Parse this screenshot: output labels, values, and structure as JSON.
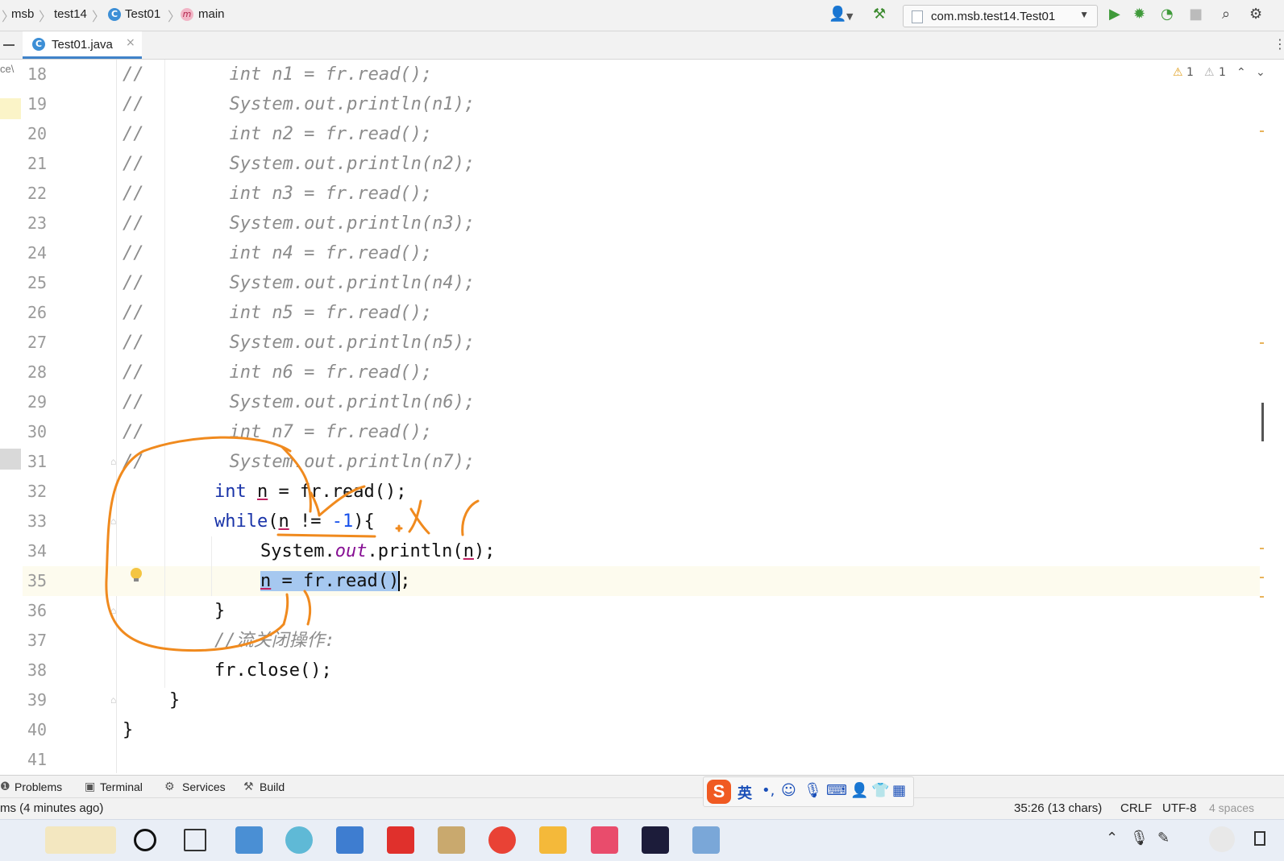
{
  "breadcrumb": {
    "project": "msb",
    "module": "test14",
    "class": "Test01",
    "method": "main"
  },
  "run_config": {
    "label": "com.msb.test14.Test01"
  },
  "tab": {
    "label": "Test01.java"
  },
  "left_cutoff": "ce\\",
  "inspections": {
    "warnings": "1",
    "weak_warnings": "1"
  },
  "code_lines": [
    {
      "n": "18"
    },
    {
      "n": "19"
    },
    {
      "n": "20"
    },
    {
      "n": "21"
    },
    {
      "n": "22"
    },
    {
      "n": "23"
    },
    {
      "n": "24"
    },
    {
      "n": "25"
    },
    {
      "n": "26"
    },
    {
      "n": "27"
    },
    {
      "n": "28"
    },
    {
      "n": "29"
    },
    {
      "n": "30"
    },
    {
      "n": "31"
    },
    {
      "n": "32"
    },
    {
      "n": "33"
    },
    {
      "n": "34"
    },
    {
      "n": "35"
    },
    {
      "n": "36"
    },
    {
      "n": "37"
    },
    {
      "n": "38"
    },
    {
      "n": "39"
    },
    {
      "n": "40"
    },
    {
      "n": "41"
    }
  ],
  "code": {
    "c18": "//        int n1 = fr.read();",
    "c19": "//        System.out.println(n1);",
    "c20": "//        int n2 = fr.read();",
    "c21": "//        System.out.println(n2);",
    "c22": "//        int n3 = fr.read();",
    "c23": "//        System.out.println(n3);",
    "c24": "//        int n4 = fr.read();",
    "c25": "//        System.out.println(n4);",
    "c26": "//        int n5 = fr.read();",
    "c27": "//        System.out.println(n5);",
    "c28": "//        int n6 = fr.read();",
    "c29": "//        System.out.println(n6);",
    "c30": "//        int n7 = fr.read();",
    "c31": "//        System.out.println(n7);",
    "int_kw": "int",
    "var_n": "n",
    "l32_rest": " = fr.read();",
    "while_kw": "while",
    "paren_open": "(",
    "l33_mid": " != ",
    "l33_num": "-1",
    "l33_end": "){",
    "l34_a": "System.",
    "l34_out": "out",
    "l34_b": ".println(",
    "l34_c": ");",
    "l35_sel": " = fr.read()",
    "l35_end": ";",
    "l36": "}",
    "l37": "//流关闭操作:",
    "l38": "fr.close();",
    "l39": "}",
    "l40": "}"
  },
  "tool_windows": {
    "problems": "Problems",
    "terminal": "Terminal",
    "services": "Services",
    "build": "Build"
  },
  "status": {
    "message": "ms (4 minutes ago)",
    "position": "35:26 (13 chars)",
    "line_sep": "CRLF",
    "encoding": "UTF-8",
    "indent": "4 spaces"
  },
  "ime": {
    "mode": "英"
  },
  "colors": {
    "accent": "#4083c9",
    "keyword": "#1933a8",
    "comment": "#8c8c8c",
    "annotation": "#f08a1e"
  }
}
